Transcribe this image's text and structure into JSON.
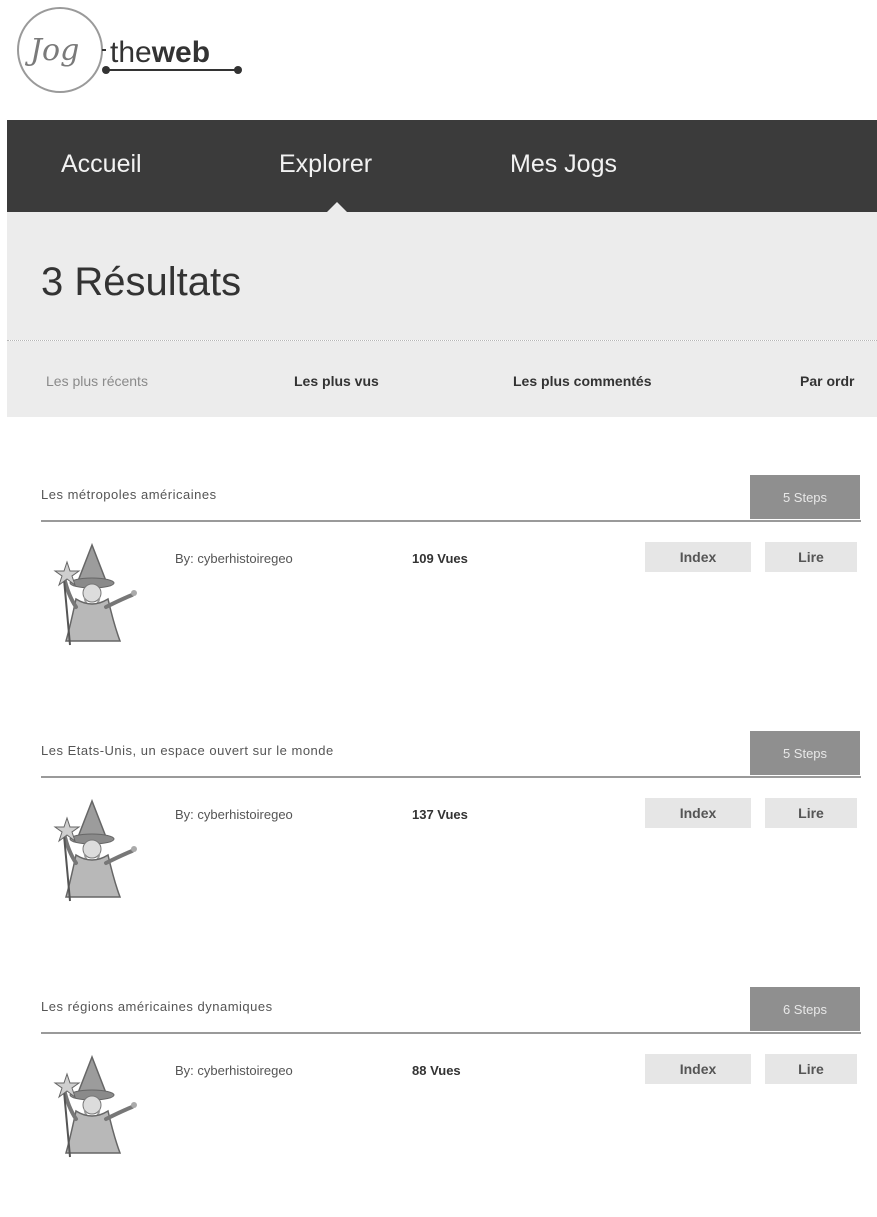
{
  "logo": {
    "mark": "Jog",
    "word_light": "the",
    "word_bold": "web"
  },
  "nav": {
    "items": [
      "Accueil",
      "Explorer",
      "Mes Jogs"
    ],
    "active": "Explorer"
  },
  "results_title": "3 Résultats",
  "sort": {
    "items": [
      "Les plus récents",
      "Les plus vus",
      "Les plus commentés",
      "Par ordr"
    ]
  },
  "results": [
    {
      "title": "Les métropoles américaines",
      "steps": "5 Steps",
      "by": "By: cyberhistoiregeo",
      "views": "109 Vues",
      "index_label": "Index",
      "read_label": "Lire",
      "avatar_icon": "wizard-icon"
    },
    {
      "title": "Les Etats-Unis, un espace ouvert sur le monde",
      "steps": "5 Steps",
      "by": "By: cyberhistoiregeo",
      "views": "137 Vues",
      "index_label": "Index",
      "read_label": "Lire",
      "avatar_icon": "wizard-icon"
    },
    {
      "title": "Les régions américaines dynamiques",
      "steps": "6 Steps",
      "by": "By: cyberhistoiregeo",
      "views": "88 Vues",
      "index_label": "Index",
      "read_label": "Lire",
      "avatar_icon": "wizard-icon"
    }
  ],
  "colors": {
    "nav_bg": "#3b3b3b",
    "header_bg": "#ececec",
    "steps_bg": "#8f8f8f",
    "button_bg": "#e6e6e6"
  }
}
